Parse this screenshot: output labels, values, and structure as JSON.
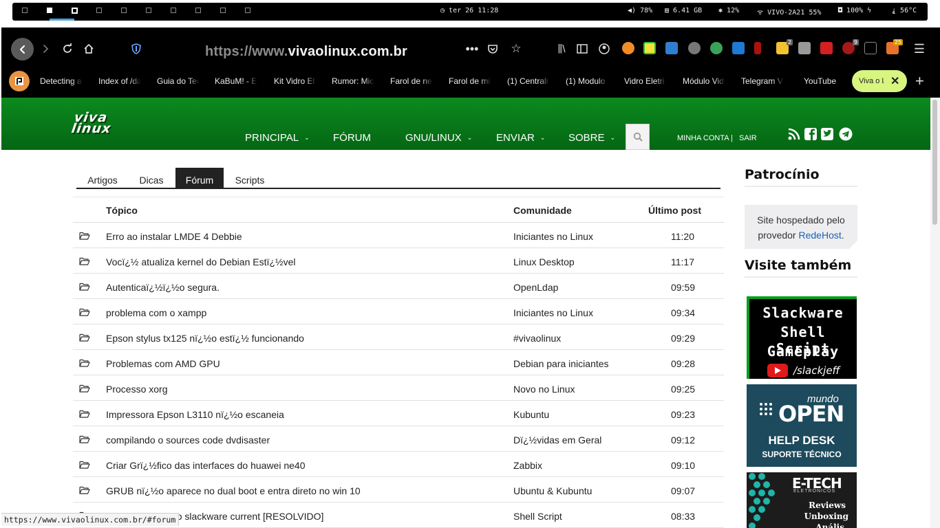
{
  "system_bar": {
    "clock": "ter 26 11:28",
    "volume": "78%",
    "memory": "6.41 GB",
    "cpu": "12%",
    "wifi": "VIVO-2A21 55%",
    "battery": "100%",
    "temperature": "56°C"
  },
  "browser": {
    "url_prefix": "https://www.",
    "url_host": "vivaolinux.com.br",
    "bookmarks": [
      "Detecting a",
      "Index of /da",
      "Guia do Tec",
      "KaBuM! - E",
      "Kit Vidro El",
      "Rumor: Mic",
      "Farol de ne",
      "Farol de mi",
      "(1) Centrali",
      "(1) Modulo",
      "Vidro Eletri",
      "Módulo Vid",
      "Telegram V",
      "YouTube"
    ],
    "active_tab": "Viva o L",
    "ext_badges": {
      "a": "2",
      "b": "9",
      "c": "25"
    }
  },
  "site": {
    "logo_line1": "viva",
    "logo_line2": "linux",
    "menu": {
      "principal": "PRINCIPAL",
      "forum": "FÓRUM",
      "gnu": "GNU/LINUX",
      "enviar": "ENVIAR",
      "sobre": "SOBRE"
    },
    "account": "MINHA CONTA |",
    "logout": "SAIR"
  },
  "tabs": [
    "Artigos",
    "Dicas",
    "Fórum",
    "Scripts"
  ],
  "table": {
    "headers": {
      "topic": "Tópico",
      "community": "Comunidade",
      "last_post": "Último post"
    },
    "rows": [
      {
        "topic": "Erro ao instalar LMDE 4 Debbie",
        "community": "Iniciantes no Linux",
        "time": "11:20"
      },
      {
        "topic": "Vocï¿½ atualiza kernel do Debian Estï¿½vel",
        "community": "Linux Desktop",
        "time": "11:17"
      },
      {
        "topic": "Autenticaï¿½ï¿½o segura.",
        "community": "OpenLdap",
        "time": "09:59"
      },
      {
        "topic": "problema com o xampp",
        "community": "Iniciantes no Linux",
        "time": "09:34"
      },
      {
        "topic": "Epson stylus tx125 nï¿½o estï¿½ funcionando",
        "community": "#vivaolinux",
        "time": "09:29"
      },
      {
        "topic": "Problemas com AMD GPU",
        "community": "Debian para iniciantes",
        "time": "09:28"
      },
      {
        "topic": "Processo xorg",
        "community": "Novo no Linux",
        "time": "09:25"
      },
      {
        "topic": "Impressora Epson L3110 nï¿½o escaneia",
        "community": "Kubuntu",
        "time": "09:23"
      },
      {
        "topic": "compilando o sources code dvdisaster",
        "community": "Dï¿½vidas em Geral",
        "time": "09:12"
      },
      {
        "topic": "Criar Grï¿½fico das interfaces do huawei ne40",
        "community": "Zabbix",
        "time": "09:10"
      },
      {
        "topic": "GRUB nï¿½o aparece no dual boot e entra direto no win 10",
        "community": "Ubuntu & Kubuntu",
        "time": "09:07"
      },
      {
        "topic": "esse comando no slackware current [RESOLVIDO]",
        "community": "Shell Script",
        "time": "08:33"
      }
    ]
  },
  "sidebar": {
    "sponsor_title": "Patrocínio",
    "hosted_text": "Site hospedado pelo provedor",
    "hosted_link": "RedeHost",
    "visit_title": "Visite também",
    "ad1_lines": [
      "Slackware",
      "Shell Script",
      "Gameplay"
    ],
    "ad1_handle": "/slackjeff",
    "ad2_mundo": "mundo",
    "ad2_open": "OPEN",
    "ad2_help": "HELP DESK",
    "ad2_support": "SUPORTE TÉCNICO",
    "ad3_brand": "E-TECH",
    "ad3_sub": "ELETRÔNICOS",
    "ad3_lines": [
      "Reviews",
      "Unboxing",
      "Anális"
    ]
  },
  "status_url": "https://www.vivaolinux.com.br/#forum"
}
